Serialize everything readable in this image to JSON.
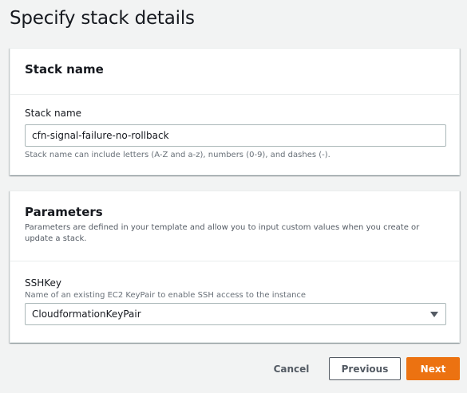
{
  "page": {
    "title": "Specify stack details"
  },
  "stack_panel": {
    "title": "Stack name",
    "field": {
      "label": "Stack name",
      "value": "cfn-signal-failure-no-rollback",
      "help": "Stack name can include letters (A-Z and a-z), numbers (0-9), and dashes (-)."
    }
  },
  "params_panel": {
    "title": "Parameters",
    "description": "Parameters are defined in your template and allow you to input custom values when you create or update a stack.",
    "field": {
      "label": "SSHKey",
      "description": "Name of an existing EC2 KeyPair to enable SSH access to the instance",
      "selected": "CloudformationKeyPair",
      "icon": "caret-down-icon"
    }
  },
  "actions": {
    "cancel": "Cancel",
    "previous": "Previous",
    "next": "Next"
  },
  "colors": {
    "primary": "#ec7211",
    "background": "#f2f3f3",
    "text": "#16191f"
  }
}
